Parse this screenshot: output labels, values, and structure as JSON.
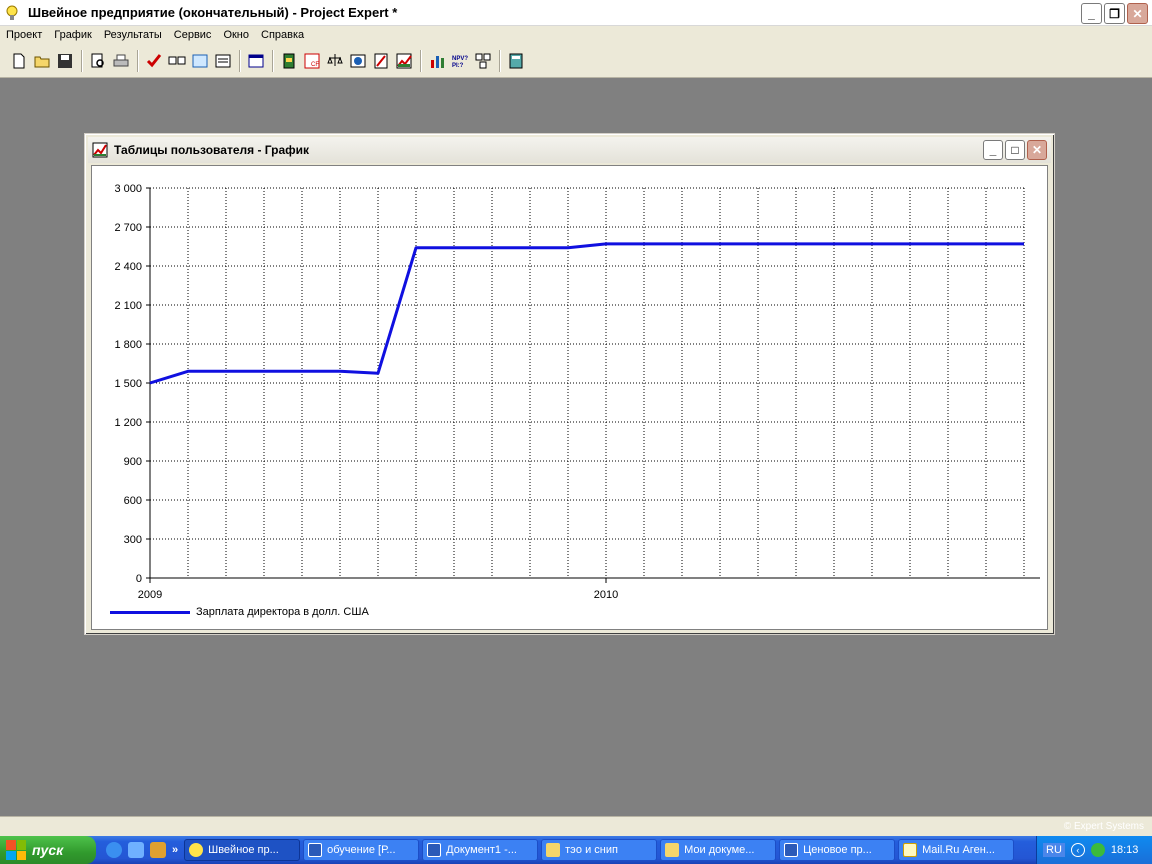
{
  "app": {
    "title": "Швейное предприятие (окончательный) - Project Expert *"
  },
  "menu": [
    "Проект",
    "График",
    "Результаты",
    "Сервис",
    "Окно",
    "Справка"
  ],
  "child_window": {
    "title": "Таблицы пользователя - График"
  },
  "chart_data": {
    "type": "line",
    "x": [
      "2009-01",
      "2009-02",
      "2009-03",
      "2009-04",
      "2009-05",
      "2009-06",
      "2009-07",
      "2009-08",
      "2009-09",
      "2009-10",
      "2009-11",
      "2009-12",
      "2010-01",
      "2010-02",
      "2010-03",
      "2010-04",
      "2010-05",
      "2010-06",
      "2010-07",
      "2010-08",
      "2010-09",
      "2010-10",
      "2010-11",
      "2010-12"
    ],
    "x_tick_labels": [
      "2009",
      "2010"
    ],
    "y_tick_labels": [
      "3 000",
      "2 700",
      "2 400",
      "2 100",
      "1 800",
      "1 500",
      "1 200",
      "900",
      "600",
      "300",
      "0"
    ],
    "ylim": [
      0,
      3000
    ],
    "grid": true,
    "legend_position": "bottom-left",
    "series": [
      {
        "name": "Зарплата директора в долл. США",
        "color": "#1010e0",
        "values": [
          1500,
          1590,
          1590,
          1590,
          1590,
          1590,
          1575,
          2540,
          2540,
          2540,
          2540,
          2540,
          2570,
          2570,
          2570,
          2570,
          2570,
          2570,
          2570,
          2570,
          2570,
          2570,
          2570,
          2570
        ]
      }
    ]
  },
  "statusbar": {
    "copyright": "© Expert Systems"
  },
  "taskbar": {
    "start_label": "пуск",
    "tasks": [
      "Швейное пр...",
      "обучение [Р...",
      "Документ1 -...",
      "тэо и снип",
      "Мои докуме...",
      "Ценовое пр...",
      "Mail.Ru Аген..."
    ],
    "lang": "RU",
    "clock": "18:13"
  },
  "icons": {
    "app": "lightbulb-icon",
    "child": "chart-icon"
  }
}
